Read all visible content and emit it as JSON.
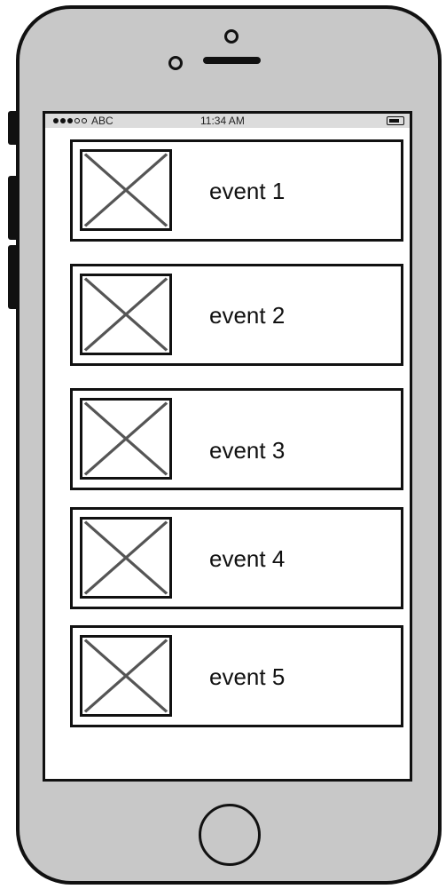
{
  "status_bar": {
    "signal_full": 3,
    "signal_empty": 2,
    "carrier": "ABC",
    "time": "11:34 AM",
    "battery_icon": "battery-icon"
  },
  "events": [
    {
      "label": "event 1",
      "thumbnail_icon": "image-placeholder-icon"
    },
    {
      "label": "event 2",
      "thumbnail_icon": "image-placeholder-icon"
    },
    {
      "label": "event 3",
      "thumbnail_icon": "image-placeholder-icon"
    },
    {
      "label": "event 4",
      "thumbnail_icon": "image-placeholder-icon"
    },
    {
      "label": "event 5",
      "thumbnail_icon": "image-placeholder-icon"
    }
  ],
  "colors": {
    "device_body": "#c8c8c8",
    "outline": "#111111",
    "status_bar_bg": "#dcdcdc",
    "placeholder_cross": "#555555"
  }
}
